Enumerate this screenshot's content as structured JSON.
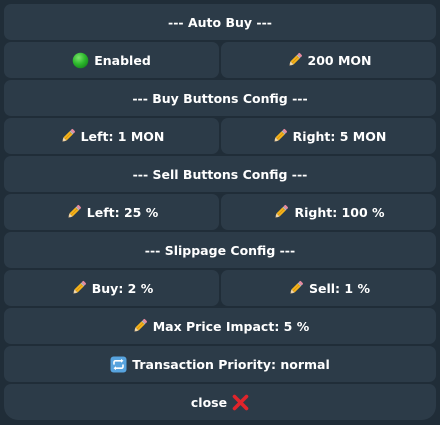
{
  "colors": {
    "background": "#202d38",
    "button": "#2c3b48",
    "text": "#ffffff",
    "enabled_dot": "#2db82d",
    "close_x": "#e0242b"
  },
  "keyboard": {
    "auto_buy_header": "--- Auto Buy ---",
    "enabled_label": "Enabled",
    "enabled_icon": "green-circle-icon",
    "amount_label": "200 MON",
    "amount_icon": "pencil-icon",
    "buy_config_header": "--- Buy Buttons Config ---",
    "buy_left_label": "Left: 1 MON",
    "buy_right_label": "Right: 5 MON",
    "sell_config_header": "--- Sell Buttons Config ---",
    "sell_left_label": "Left: 25 %",
    "sell_right_label": "Right: 100 %",
    "slippage_header": "--- Slippage Config ---",
    "slippage_buy_label": "Buy: 2 %",
    "slippage_sell_label": "Sell: 1 %",
    "max_price_impact_label": "Max Price Impact: 5 %",
    "tx_priority_label": "Transaction Priority: normal",
    "tx_priority_icon": "repeat-icon",
    "close_label": "close",
    "close_icon": "red-x-icon"
  }
}
